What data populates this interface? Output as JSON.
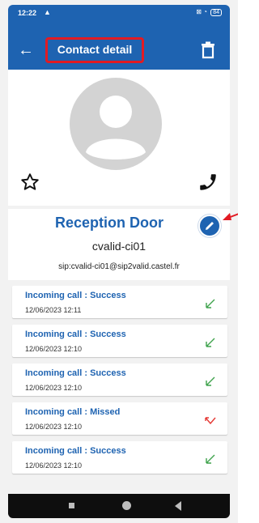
{
  "status_bar": {
    "time": "12:22",
    "warning_icon": "alert-triangle-icon",
    "battery": "84"
  },
  "app_bar": {
    "back_icon": "arrow-left-icon",
    "title": "Contact detail",
    "delete_icon": "trash-icon"
  },
  "contact": {
    "avatar_icon": "person-placeholder-icon",
    "favorite_icon": "star-outline-icon",
    "call_icon": "phone-icon",
    "name": "Reception Door",
    "edit_icon": "pencil-icon",
    "username": "cvalid-ci01",
    "sip_uri": "sip:cvalid-ci01@sip2valid.castel.fr"
  },
  "history": [
    {
      "title": "Incoming call : Success",
      "datetime": "12/06/2023 12:11",
      "status_icon": "call-received-icon",
      "color": "#3fa34d"
    },
    {
      "title": "Incoming call : Success",
      "datetime": "12/06/2023 12:10",
      "status_icon": "call-received-icon",
      "color": "#3fa34d"
    },
    {
      "title": "Incoming call : Success",
      "datetime": "12/06/2023 12:10",
      "status_icon": "call-received-icon",
      "color": "#3fa34d"
    },
    {
      "title": "Incoming call : Missed",
      "datetime": "12/06/2023 12:10",
      "status_icon": "call-missed-icon",
      "color": "#e53935"
    },
    {
      "title": "Incoming call : Success",
      "datetime": "12/06/2023 12:10",
      "status_icon": "call-received-icon",
      "color": "#3fa34d"
    }
  ],
  "colors": {
    "primary": "#1e63b1",
    "highlight": "#e21b23"
  }
}
